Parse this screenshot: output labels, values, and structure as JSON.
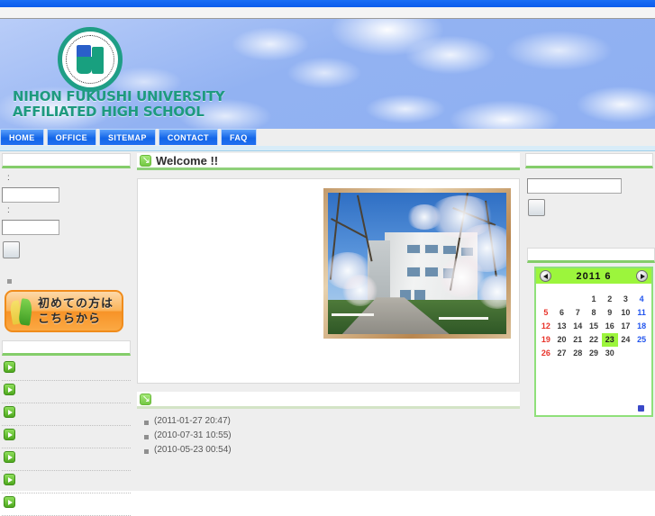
{
  "site": {
    "school_name_line1": "NIHON FUKUSHI UNIVERSITY",
    "school_name_line2": "AFFILIATED HIGH SCHOOL",
    "logo_icon": "school-crest-icon"
  },
  "nav": {
    "items": [
      {
        "label": "HOME"
      },
      {
        "label": "OFFICE"
      },
      {
        "label": "SITEMAP"
      },
      {
        "label": "CONTACT"
      },
      {
        "label": "FAQ"
      }
    ]
  },
  "left_sidebar": {
    "login": {
      "heading": "",
      "username_label": ":",
      "username_value": "",
      "username_placeholder": "",
      "password_label": ":",
      "password_value": "",
      "password_placeholder": "",
      "submit_label": ""
    },
    "bullet_marker": "",
    "banner": {
      "icon": "sprout-icon",
      "line1": "初めての方は",
      "line2": "こちらから"
    },
    "menu": {
      "heading": "",
      "items": [
        {
          "icon": "green-arrow-icon",
          "label": ""
        },
        {
          "icon": "green-arrow-icon",
          "label": ""
        },
        {
          "icon": "green-arrow-icon",
          "label": ""
        },
        {
          "icon": "green-arrow-icon",
          "label": ""
        },
        {
          "icon": "green-arrow-icon",
          "label": ""
        },
        {
          "icon": "green-arrow-icon",
          "label": ""
        },
        {
          "icon": "green-arrow-icon",
          "label": ""
        }
      ]
    }
  },
  "main": {
    "welcome": {
      "icon": "green-arrow-down-right-icon",
      "title": "Welcome !!"
    },
    "photo": {
      "alt": "school-building-with-cherry-blossoms"
    },
    "news": {
      "icon": "green-arrow-down-right-icon",
      "heading": "",
      "items": [
        {
          "title": "",
          "date": "(2011-01-27 20:47)"
        },
        {
          "title": "",
          "date": "(2010-07-31 10:55)"
        },
        {
          "title": "",
          "date": "(2010-05-23 00:54)"
        }
      ]
    }
  },
  "right_sidebar": {
    "search": {
      "heading": "",
      "value": "",
      "placeholder": "",
      "button_label": ""
    },
    "calendar": {
      "heading": "",
      "prev_icon": "chevron-left-icon",
      "next_icon": "chevron-right-icon",
      "year": "2011",
      "month": "6",
      "title": "2011  6",
      "today": 23,
      "lead_blanks": 3,
      "days_in_month": 30,
      "footer_icon": "calendar-footer-icon"
    }
  },
  "colors": {
    "accent_blue": "#1466e8",
    "accent_green": "#8fd07a",
    "calendar_highlight": "#9cf53c",
    "brand_teal": "#1e9a7f",
    "banner_orange": "#f79327",
    "sunday_red": "#e8332a",
    "saturday_blue": "#2255ee"
  }
}
